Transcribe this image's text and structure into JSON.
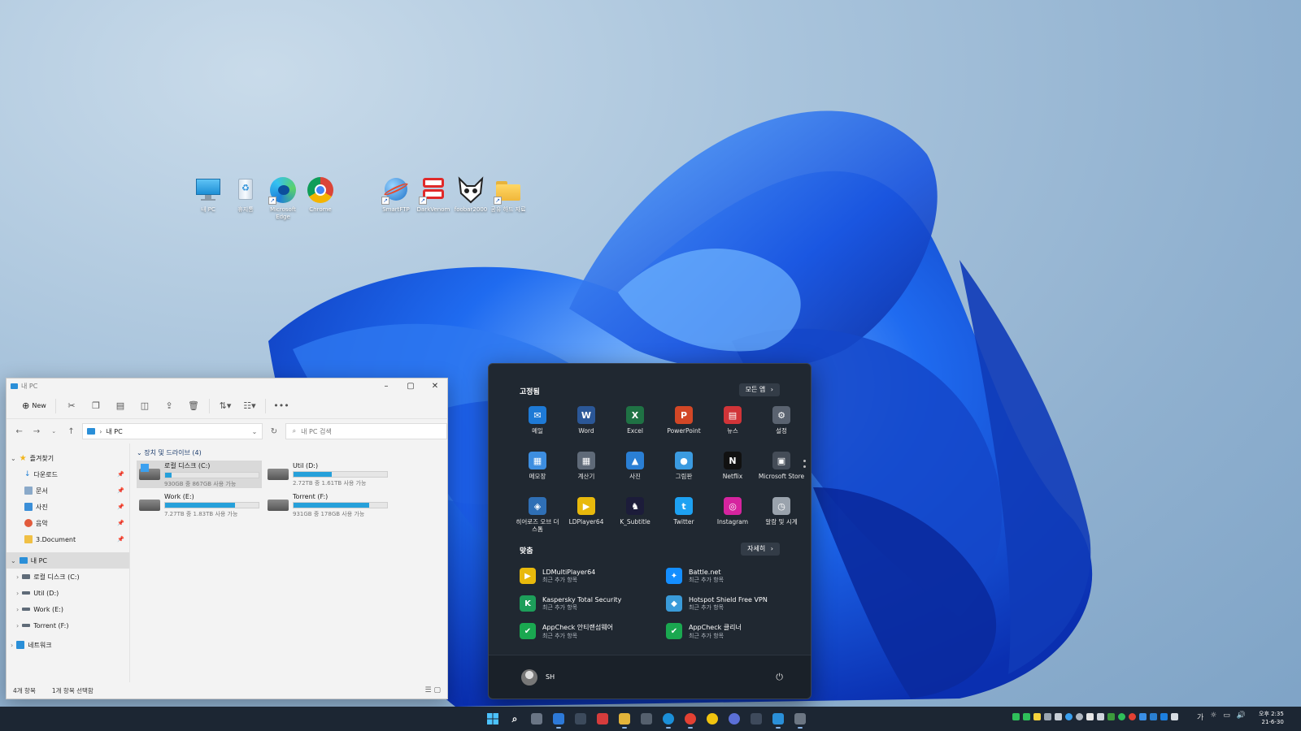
{
  "desktop": {
    "icons": [
      {
        "label": "내 PC"
      },
      {
        "label": "휴지통"
      },
      {
        "label": "Microsoft Edge"
      },
      {
        "label": "Chrome"
      },
      {
        "label": "SmartFTP"
      },
      {
        "label": "DarkVenom"
      },
      {
        "label": "foobar2000"
      },
      {
        "label": "공유 하드 자료"
      }
    ]
  },
  "explorer": {
    "title": "내 PC",
    "toolbar": {
      "new_label": "New",
      "more_label": "•••"
    },
    "address": {
      "location": "내 PC"
    },
    "search": {
      "placeholder": "내 PC 검색"
    },
    "nav": {
      "quick_access": "즐겨찾기",
      "quick_items": [
        "다운로드",
        "문서",
        "사진",
        "음악",
        "3.Document"
      ],
      "this_pc": "내 PC",
      "pc_items": [
        "로컬 디스크 (C:)",
        "Util (D:)",
        "Work (E:)",
        "Torrent (F:)"
      ],
      "network": "네트워크"
    },
    "group_header": "장치 및 드라이브 (4)",
    "drives": [
      {
        "name": "로컬 디스크 (C:)",
        "space": "930GB 중 867GB 사용 가능",
        "used_fraction": 0.07
      },
      {
        "name": "Util (D:)",
        "space": "2.72TB 중 1.61TB 사용 가능",
        "used_fraction": 0.41
      },
      {
        "name": "Work (E:)",
        "space": "7.27TB 중 1.83TB 사용 가능",
        "used_fraction": 0.75
      },
      {
        "name": "Torrent (F:)",
        "space": "931GB 중 178GB 사용 가능",
        "used_fraction": 0.81
      }
    ],
    "status": {
      "item_count": "4개 항목",
      "selected": "1개 항목 선택함"
    }
  },
  "start_menu": {
    "pinned_header": "고정됨",
    "all_apps_label": "모든 앱",
    "pinned": [
      {
        "label": "메일",
        "color": "#1e7ad6",
        "glyph": "✉"
      },
      {
        "label": "Word",
        "color": "#2b5797",
        "glyph": "W"
      },
      {
        "label": "Excel",
        "color": "#1f7244",
        "glyph": "X"
      },
      {
        "label": "PowerPoint",
        "color": "#d24726",
        "glyph": "P"
      },
      {
        "label": "뉴스",
        "color": "#d13438",
        "glyph": "▤"
      },
      {
        "label": "설정",
        "color": "#5a6370",
        "glyph": "⚙"
      },
      {
        "label": "메모장",
        "color": "#3d8ee0",
        "glyph": "▦"
      },
      {
        "label": "계산기",
        "color": "#5f6a78",
        "glyph": "▦"
      },
      {
        "label": "사진",
        "color": "#2a7fd4",
        "glyph": "▲"
      },
      {
        "label": "그림판",
        "color": "#3b9be0",
        "glyph": "●"
      },
      {
        "label": "Netflix",
        "color": "#111111",
        "glyph": "N"
      },
      {
        "label": "Microsoft Store",
        "color": "#444c57",
        "glyph": "▣"
      },
      {
        "label": "히어로즈 오브 더 스톰",
        "color": "#2f6fb5",
        "glyph": "◈"
      },
      {
        "label": "LDPlayer64",
        "color": "#e8b90c",
        "glyph": "▶"
      },
      {
        "label": "K_Subtitle",
        "color": "#1c1c3a",
        "glyph": "♞"
      },
      {
        "label": "Twitter",
        "color": "#1da1f2",
        "glyph": "t"
      },
      {
        "label": "Instagram",
        "color": "#d6249f",
        "glyph": "◎"
      },
      {
        "label": "알람 및 시계",
        "color": "#9aa3ad",
        "glyph": "◷"
      }
    ],
    "recommended_header": "맞춤",
    "more_label": "자세히",
    "recommended": [
      {
        "name": "LDMultiPlayer64",
        "sub": "최근 추가 항목",
        "color": "#e8b90c",
        "glyph": "▶"
      },
      {
        "name": "Battle.net",
        "sub": "최근 추가 항목",
        "color": "#148eff",
        "glyph": "✦"
      },
      {
        "name": "Kaspersky Total Security",
        "sub": "최근 추가 항목",
        "color": "#1d9e5a",
        "glyph": "K"
      },
      {
        "name": "Hotspot Shield Free VPN",
        "sub": "최근 추가 항목",
        "color": "#3a9bd9",
        "glyph": "◆"
      },
      {
        "name": "AppCheck 안티랜섬웨어",
        "sub": "최근 추가 항목",
        "color": "#1aa850",
        "glyph": "✔"
      },
      {
        "name": "AppCheck 클리너",
        "sub": "최근 추가 항목",
        "color": "#1aa850",
        "glyph": "✔"
      }
    ],
    "user": {
      "name": "SH"
    }
  },
  "taskbar": {
    "apps": [
      {
        "name": "start",
        "color": "#3a8fe6"
      },
      {
        "name": "search",
        "color": "#5a6b80"
      },
      {
        "name": "task-view",
        "color": "#6a7585"
      },
      {
        "name": "widgets",
        "color": "#2d79d8"
      },
      {
        "name": "app-5",
        "color": "#3c4a5c"
      },
      {
        "name": "app-6",
        "color": "#d63c3c"
      },
      {
        "name": "file-explorer",
        "color": "#e3b43a"
      },
      {
        "name": "app-8",
        "color": "#55606e"
      },
      {
        "name": "edge",
        "color": "#1b8fd8"
      },
      {
        "name": "chrome",
        "color": "#e34133"
      },
      {
        "name": "app-11",
        "color": "#f1c40f"
      },
      {
        "name": "app-12",
        "color": "#5b6fd6"
      },
      {
        "name": "app-13",
        "color": "#3e4a5c"
      },
      {
        "name": "app-14",
        "color": "#2a8fd8"
      },
      {
        "name": "settings",
        "color": "#6c7683"
      }
    ],
    "ime": "가",
    "clock": {
      "time": "오후 2:35",
      "date": "21-6-30"
    }
  }
}
